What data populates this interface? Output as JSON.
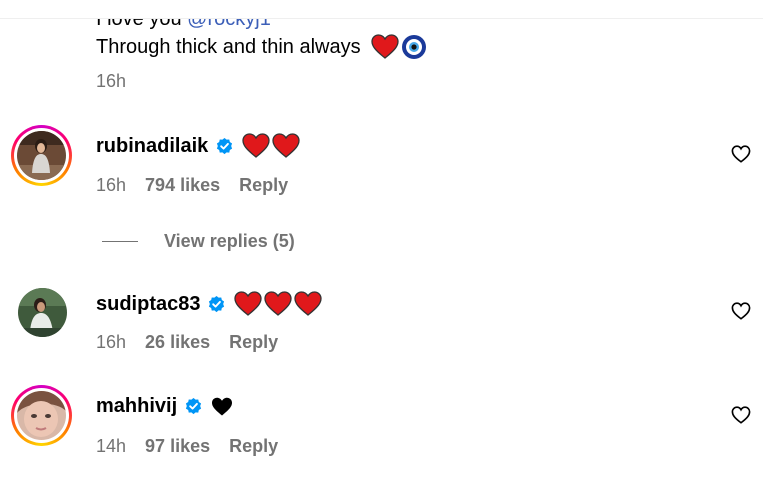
{
  "previous_comment": {
    "text_start": "I love you ",
    "mention": "@rockyj1",
    "line2": "Through thick and thin always",
    "time": "16h"
  },
  "comments": [
    {
      "username": "rubinadilaik",
      "time": "16h",
      "likes": "794 likes",
      "reply": "Reply",
      "view_replies": "View replies (5)"
    },
    {
      "username": "sudiptac83",
      "time": "16h",
      "likes": "26 likes",
      "reply": "Reply"
    },
    {
      "username": "mahhivij",
      "time": "14h",
      "likes": "97 likes",
      "reply": "Reply"
    }
  ],
  "colors": {
    "muted": "#737373",
    "verified": "#0095f6",
    "heart_red": "#e0181b",
    "mention": "#3c5fb8"
  }
}
